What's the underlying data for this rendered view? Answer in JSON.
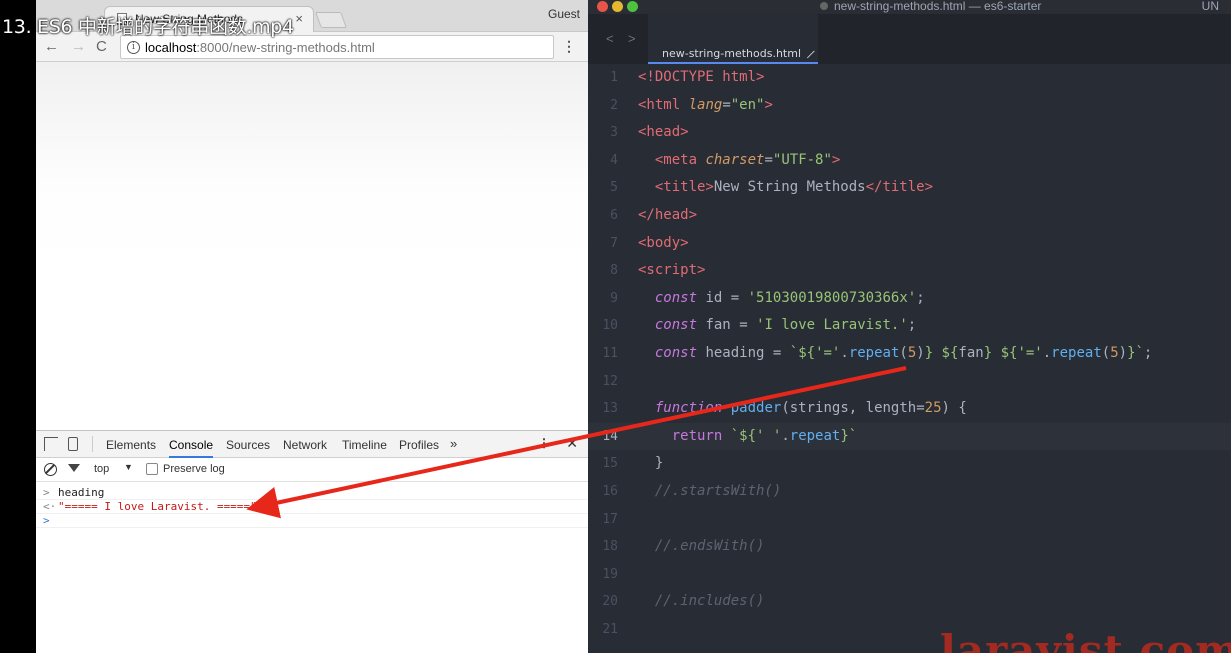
{
  "video": {
    "title": "13. ES6 中新增的字符串函数.mp4"
  },
  "browser": {
    "tab_title": "New String Methods",
    "tab_close": "×",
    "guest_label": "Guest",
    "nav": {
      "back": "←",
      "forward": "→",
      "reload": "C"
    },
    "url_host": "localhost",
    "url_path": ":8000/new-string-methods.html",
    "menu": "⋮"
  },
  "devtools": {
    "tabs": [
      "Elements",
      "Console",
      "Sources",
      "Network",
      "Timeline",
      "Profiles"
    ],
    "active_tab": "Console",
    "more": "»",
    "context": "top",
    "context_caret": "▼",
    "preserve_log": "Preserve log",
    "console": [
      {
        "type": "input",
        "chevron": ">",
        "text": "heading"
      },
      {
        "type": "output",
        "chevron": "<·",
        "text": "\"===== I love Laravist. =====\""
      }
    ],
    "prompt_chevron": ">"
  },
  "editor": {
    "window_title": "new-string-methods.html — es6-starter",
    "right_label": "UN",
    "tab_label": "new-string-methods.html",
    "nav_left": "<",
    "nav_right": ">",
    "watermark": "laravist.com",
    "line_numbers": [
      "1",
      "2",
      "3",
      "4",
      "5",
      "6",
      "7",
      "8",
      "9",
      "10",
      "11",
      "12",
      "13",
      "14",
      "15",
      "16",
      "17",
      "18",
      "19",
      "20",
      "21"
    ],
    "current_line": 14
  },
  "colors": {
    "editor_bg": "#282c34",
    "arrow": "#e8271b",
    "console_output": "#c41a16",
    "tab_accent": "#568af2"
  }
}
